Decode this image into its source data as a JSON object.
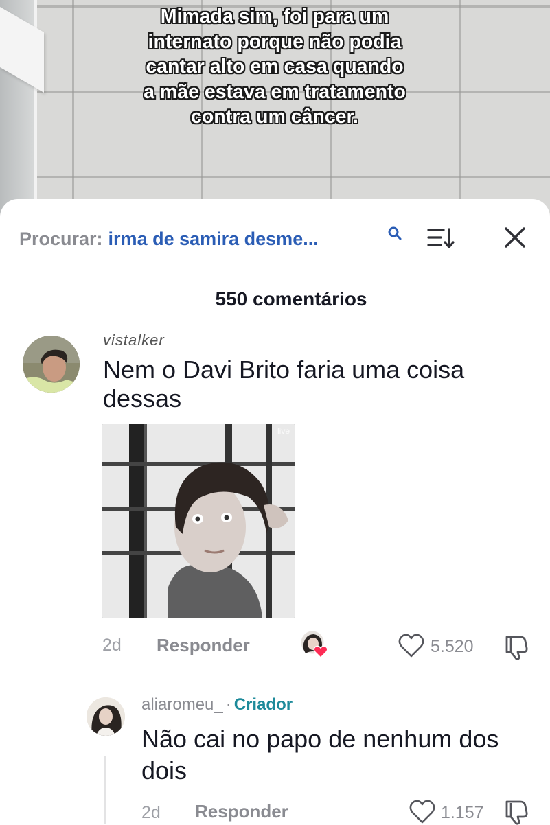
{
  "video": {
    "caption_lines": [
      "Mimada sim, foi para um",
      "internato porque não podia",
      "cantar alto em casa quando",
      "a mãe estava em tratamento",
      "contra um câncer."
    ]
  },
  "search": {
    "prefix": "Procurar:",
    "query": "irma de samira desme..."
  },
  "comments_header": {
    "count_label": "550 comentários"
  },
  "comments": [
    {
      "username": "vistalker",
      "text": "Nem o Davi Brito faria uma coisa dessas",
      "gif_watermark": "live",
      "time": "2d",
      "reply_label": "Responder",
      "likes": "5.520"
    }
  ],
  "replies": [
    {
      "username": "aliaromeu_",
      "separator": "·",
      "badge": "Criador",
      "text": "Não cai no papo de nenhum dos dois",
      "time": "2d",
      "reply_label": "Responder",
      "likes": "1.157"
    }
  ],
  "colors": {
    "link_blue": "#2b5db5",
    "creator_teal": "#1d8a9a",
    "heart_red": "#fe2c55",
    "text_primary": "#161823",
    "text_secondary": "#8a8b91"
  },
  "icons": [
    "search-icon",
    "sort-icon",
    "close-icon",
    "heart-icon",
    "dislike-icon",
    "creator-liked-icon"
  ]
}
